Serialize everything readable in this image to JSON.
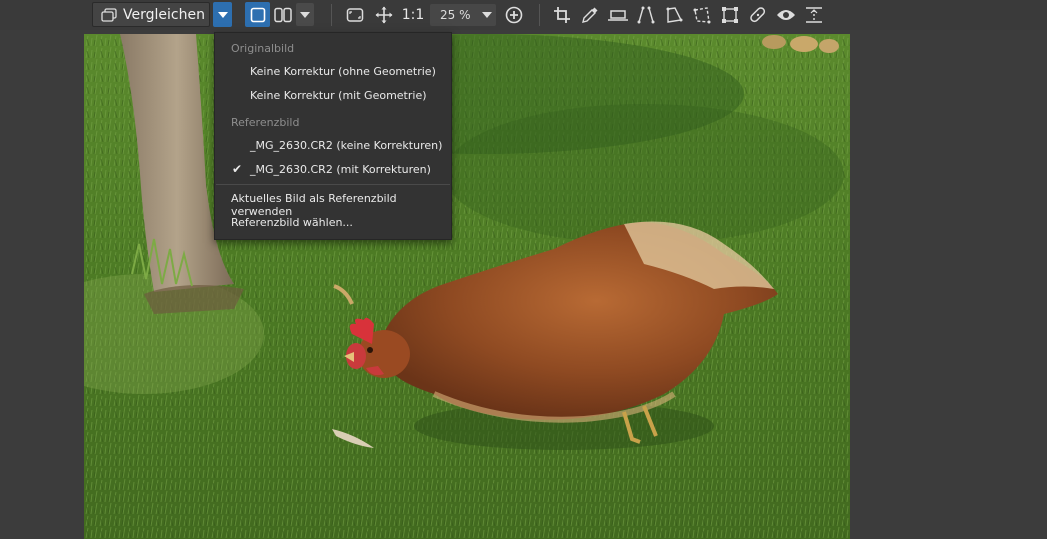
{
  "toolbar": {
    "compare_label": "Vergleichen",
    "one_to_one": "1:1",
    "zoom_value": "25 %",
    "icons": [
      "compare-icon",
      "chevron-down-icon",
      "single-view-icon",
      "split-view-icon",
      "fit-icon",
      "move-icon",
      "zoom-in-icon",
      "crop-icon",
      "eyedropper-icon",
      "horizon-icon",
      "vertical-perspective-icon",
      "perspective-icon",
      "free-perspective-icon",
      "transform-icon",
      "retouch-icon",
      "eye-icon",
      "split-line-icon"
    ]
  },
  "menu": {
    "section1": "Originalbild",
    "item1": "Keine Korrektur (ohne Geometrie)",
    "item2": "Keine Korrektur (mit Geometrie)",
    "section2": "Referenzbild",
    "item3": "_MG_2630.CR2 (keine Korrekturen)",
    "item4": "_MG_2630.CR2 (mit Korrekturen)",
    "item4_checked": true,
    "item5": "Aktuelles Bild als Referenzbild verwenden",
    "item6": "Referenzbild wählen..."
  },
  "colors": {
    "accent": "#2d6fb0",
    "toolbar_bg": "#3a3a3a",
    "menu_bg": "#333333",
    "grass": "#4f7a2a",
    "hen": "#8b4a22"
  }
}
